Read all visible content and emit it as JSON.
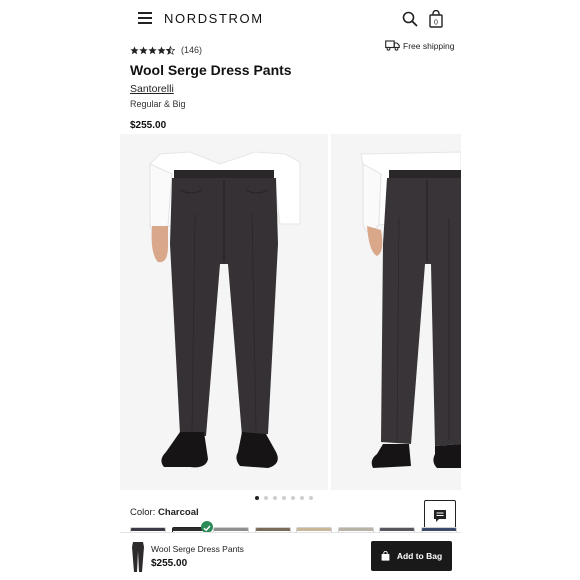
{
  "header": {
    "logo": "NORDSTROM",
    "menu_icon": "hamburger-menu-icon",
    "search_icon": "search-icon",
    "bag_icon": "shopping-bag-icon",
    "bag_count": "0"
  },
  "product": {
    "rating": 4.5,
    "review_count": "(146)",
    "shipping": "Free shipping",
    "title": "Wool Serge Dress Pants",
    "brand": "Santorelli",
    "fit": "Regular & Big",
    "price": "$255.00"
  },
  "gallery": {
    "image_count": 7,
    "active_index": 0
  },
  "color": {
    "label": "Color:",
    "selected": "Charcoal",
    "swatch_count": 8,
    "selected_index": 1
  },
  "sticky_bar": {
    "title": "Wool Serge Dress Pants",
    "price": "$255.00",
    "add_to_bag": "Add to Bag"
  },
  "colors": {
    "charcoal": "#2e2b2d",
    "accent_green": "#2e8b57",
    "button_dark": "#191919"
  }
}
